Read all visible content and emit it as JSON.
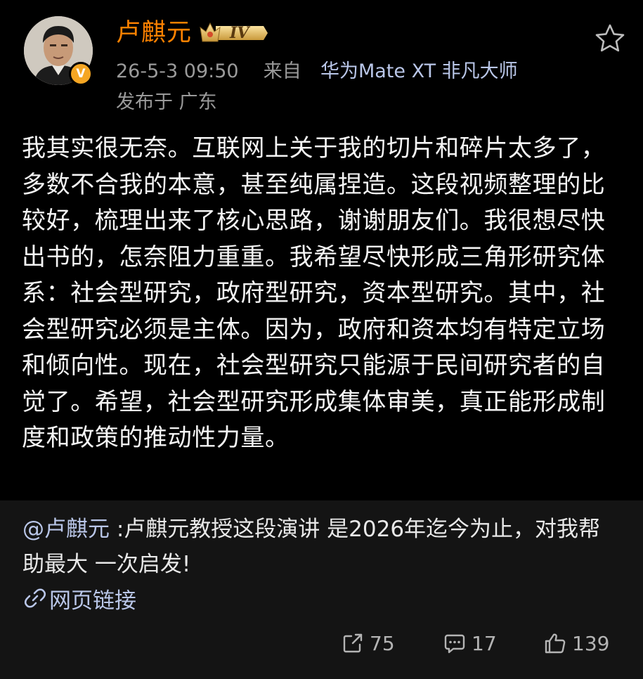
{
  "post": {
    "author_name": "卢麒元",
    "level_badge": "IV",
    "verified_mark": "V",
    "timestamp": "26-5-3 09:50",
    "from_label": "来自",
    "device": "华为Mate XT 非凡大师",
    "location": "发布于 广东",
    "body": "我其实很无奈。互联网上关于我的切片和碎片太多了，多数不合我的本意，甚至纯属捏造。这段视频整理的比较好，梳理出来了核心思路，谢谢朋友们。我很想尽快出书的，怎奈阻力重重。我希望尽快形成三角形研究体系：社会型研究，政府型研究，资本型研究。其中，社会型研究必须是主体。因为，政府和资本均有特定立场和倾向性。现在，社会型研究只能源于民间研究者的自觉了。希望，社会型研究形成集体审美，真正能形成制度和政策的推动性力量。"
  },
  "repost": {
    "mention": "@卢麒元",
    "text": " :卢麒元教授这段演讲 是2026年迄今为止，对我帮助最大 一次启发!",
    "link_label": "网页链接"
  },
  "actions": {
    "repost_count": "75",
    "comment_count": "17",
    "like_count": "139"
  },
  "icons": {
    "star": "star-outline-icon",
    "link": "link-icon",
    "repost": "share-icon",
    "comment": "comment-icon",
    "like": "thumbs-up-icon"
  },
  "colors": {
    "author_name": "#ff8200",
    "link_blue": "#b9c6e8",
    "meta_gray": "#9a9a9a",
    "badge_gold": "#f5a623",
    "card_bg": "#141414"
  }
}
